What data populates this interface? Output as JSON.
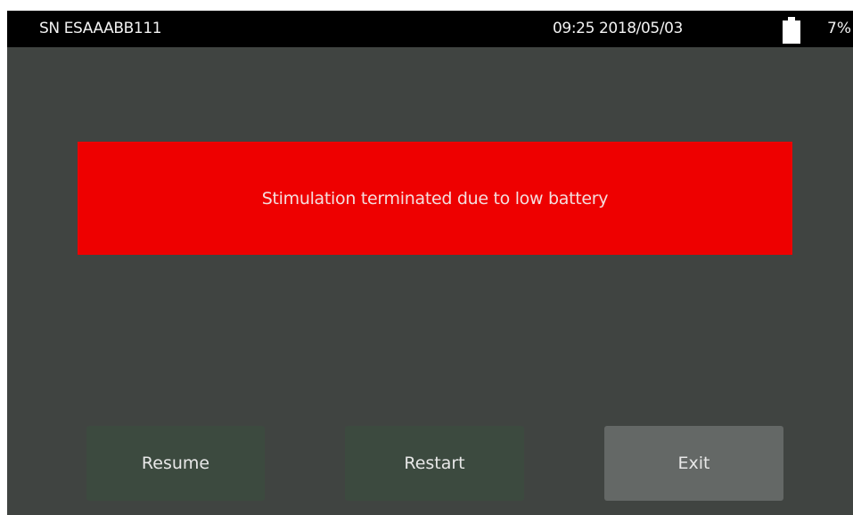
{
  "status_bar": {
    "serial": "SN ESAAABB111",
    "datetime": "09:25 2018/05/03",
    "battery_icon": "battery-icon",
    "battery_percent": "7%"
  },
  "alert": {
    "message": "Stimulation terminated due to low battery",
    "color": "#ee0000"
  },
  "buttons": {
    "resume": "Resume",
    "restart": "Restart",
    "exit": "Exit"
  },
  "colors": {
    "background": "#404441",
    "status_bar": "#000000",
    "button": "#3c4a3f",
    "button_exit": "#646866"
  }
}
